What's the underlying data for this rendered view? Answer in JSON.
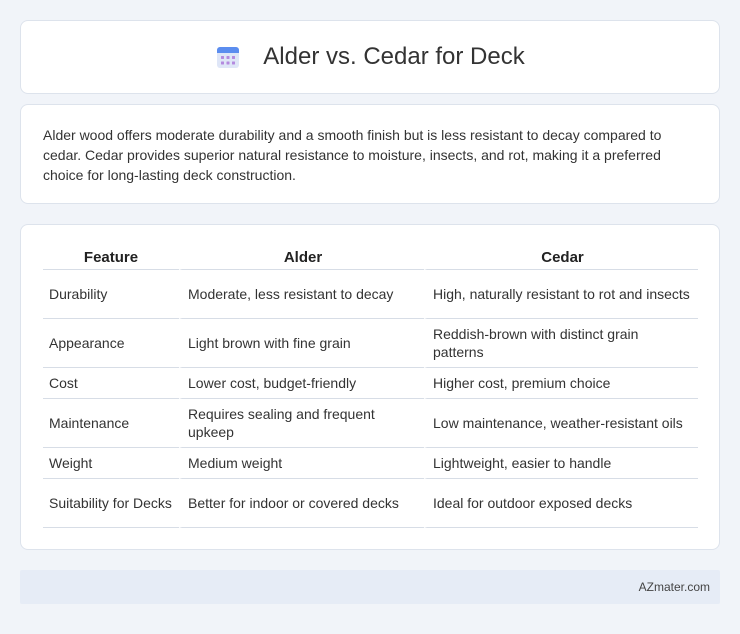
{
  "header": {
    "title": "Alder vs. Cedar for Deck",
    "icon": "calendar-icon"
  },
  "intro": {
    "text": "Alder wood offers moderate durability and a smooth finish but is less resistant to decay compared to cedar. Cedar provides superior natural resistance to moisture, insects, and rot, making it a preferred choice for long-lasting deck construction."
  },
  "table": {
    "headers": [
      "Feature",
      "Alder",
      "Cedar"
    ],
    "rows": [
      [
        "Durability",
        "Moderate, less resistant to decay",
        "High, naturally resistant to rot and insects"
      ],
      [
        "Appearance",
        "Light brown with fine grain",
        "Reddish-brown with distinct grain patterns"
      ],
      [
        "Cost",
        "Lower cost, budget-friendly",
        "Higher cost, premium choice"
      ],
      [
        "Maintenance",
        "Requires sealing and frequent upkeep",
        "Low maintenance, weather-resistant oils"
      ],
      [
        "Weight",
        "Medium weight",
        "Lightweight, easier to handle"
      ],
      [
        "Suitability for Decks",
        "Better for indoor or covered decks",
        "Ideal for outdoor exposed decks"
      ]
    ]
  },
  "footer": {
    "brand": "AZmater.com"
  }
}
